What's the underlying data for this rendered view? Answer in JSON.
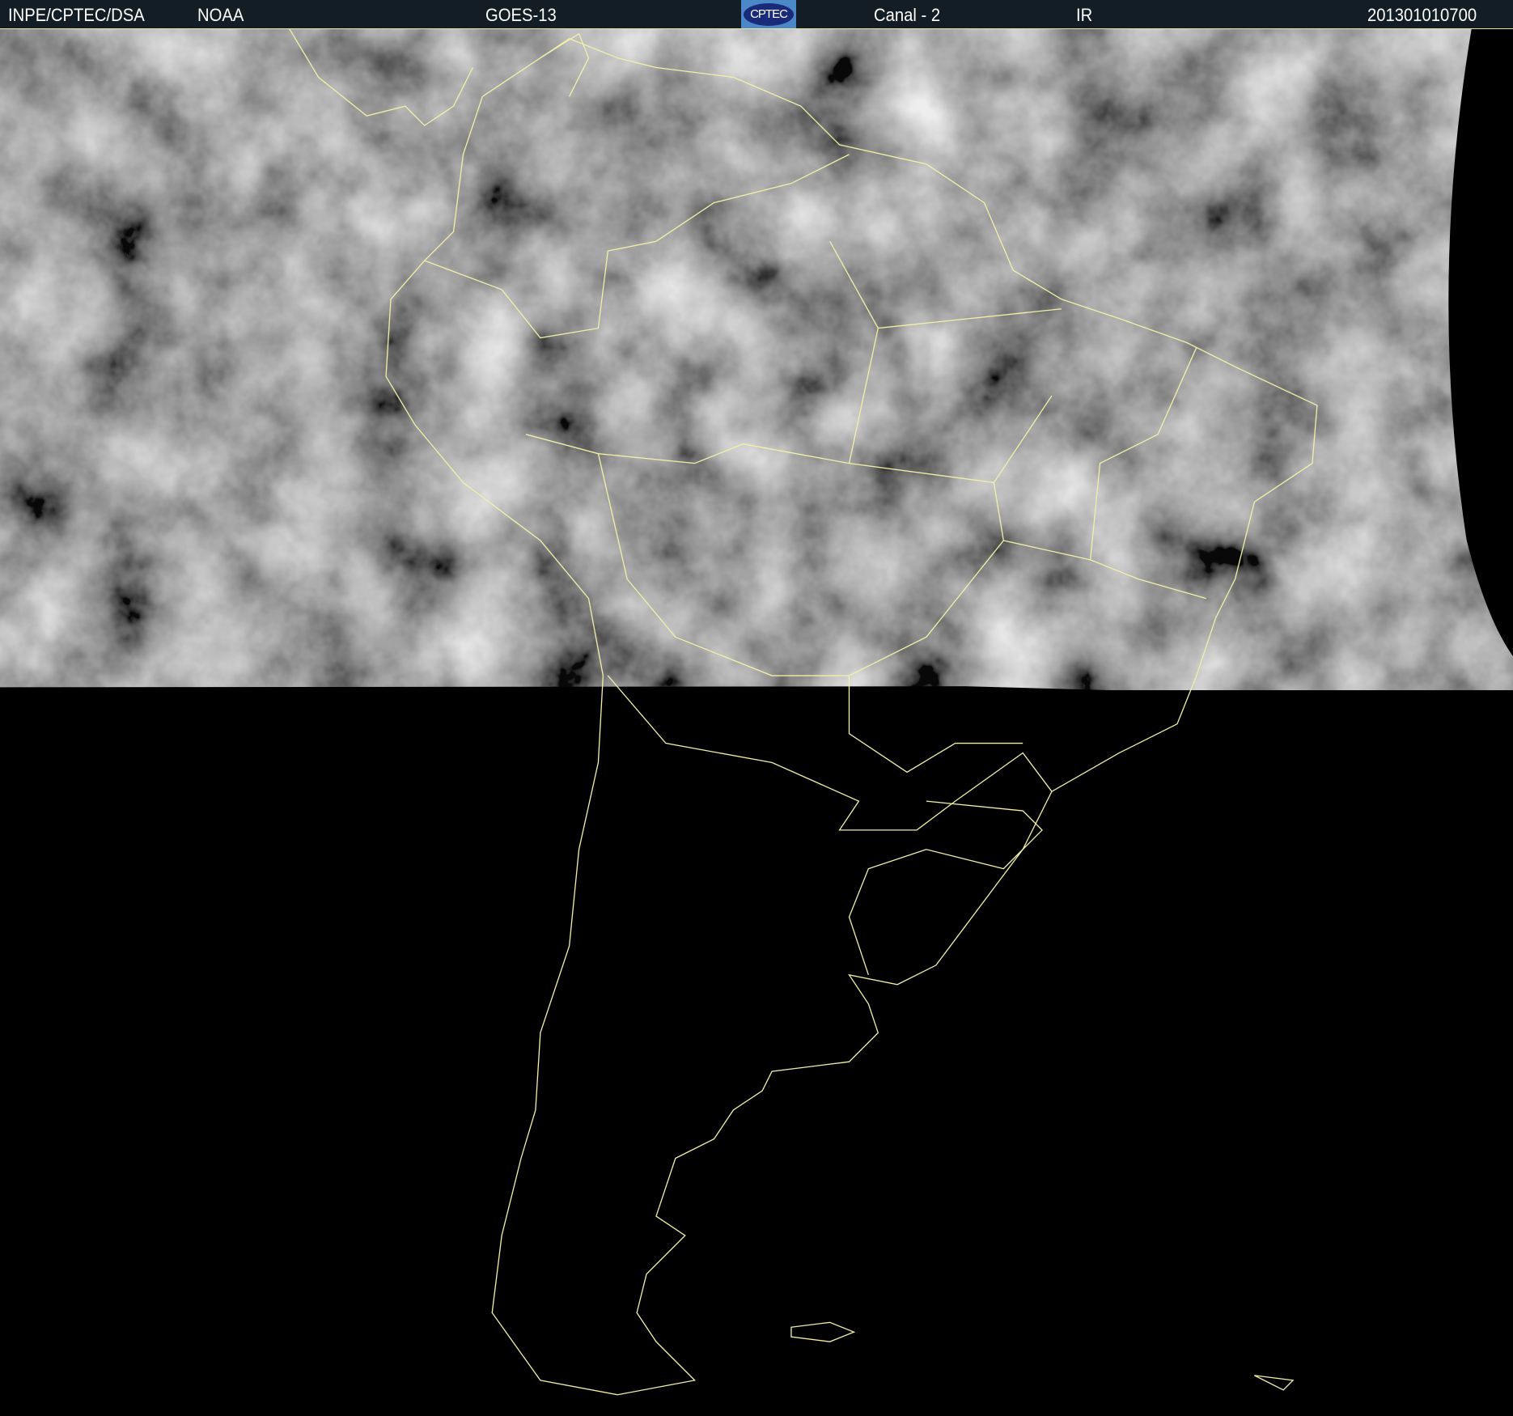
{
  "header": {
    "source": "INPE/CPTEC/DSA",
    "agency": "NOAA",
    "satellite": "GOES-13",
    "logo_text": "CPTEC",
    "channel": "Canal - 2",
    "band": "IR",
    "timestamp": "201301010700"
  },
  "colors": {
    "header_bg": "#121d25",
    "coastline": "#f0f0a8",
    "night": "#000000"
  }
}
